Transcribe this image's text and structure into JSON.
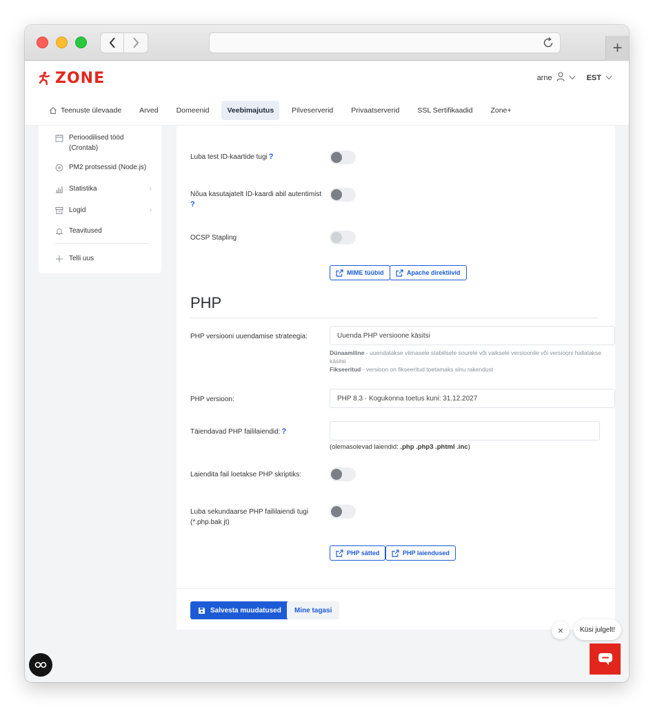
{
  "brand": {
    "logo_text": "ZONE",
    "accent": "#e3261d",
    "link": "#1d5bd6"
  },
  "user": {
    "name": "arne",
    "language": "EST"
  },
  "nav": {
    "items": [
      {
        "label": "Teenuste ülevaade",
        "icon": "home-icon"
      },
      {
        "label": "Arved"
      },
      {
        "label": "Domeenid"
      },
      {
        "label": "Veebimajutus",
        "active": true
      },
      {
        "label": "Pilveserverid"
      },
      {
        "label": "Privaatserverid"
      },
      {
        "label": "SSL Sertifikaadid"
      },
      {
        "label": "Zone+"
      }
    ]
  },
  "sidebar": {
    "items": [
      {
        "label": "Perioodilised tööd (Crontab)",
        "icon": "calendar-icon"
      },
      {
        "label": "PM2 protsessid (Node.js)",
        "icon": "nodejs-icon"
      },
      {
        "label": "Statistika",
        "icon": "chart-icon",
        "arrow": "›"
      },
      {
        "label": "Logid",
        "icon": "archive-icon",
        "arrow": "›"
      },
      {
        "label": "Teavitused",
        "icon": "bell-icon"
      }
    ],
    "order_new": "Telli uus"
  },
  "settings": {
    "id_card_test_label": "Luba test ID-kaartide tugi",
    "id_card_auth_label": "Nõua kasutajatelt ID-kaardi abil autentimist",
    "ocsp_label": "OCSP Stapling",
    "help_mark": "?",
    "mime_button": "MIME tüübid",
    "apache_button": "Apache direktiivid"
  },
  "php": {
    "section_title": "PHP",
    "strategy_label": "PHP versiooni uuendamise strateegia:",
    "strategy_value": "Uuenda PHP versioone käsitsi",
    "hint_dynamic_term": "Dünaamiline",
    "hint_dynamic_text": " - uuendatakse viimasele stabiilsele sourele või vaiksele versioonile või versiooni hallatakse käsitsi",
    "hint_fixed_term": "Fikseeritud",
    "hint_fixed_text": " - versioon on fikseeritud toetamaks sinu rakendust",
    "version_label": "PHP versioon:",
    "version_value": "PHP 8.3 · Kogukonna toetus kuni: 31.12.2027",
    "extensions_label": "Täiendavad PHP faililaiendid:",
    "extensions_value": "",
    "existing_prefix": "(olemasolevad laiendid: ",
    "existing_list": ".php .php3 .phtml .inc",
    "existing_suffix": ")",
    "no_ext_label": "Laiendita fail loetakse PHP skriptiks:",
    "secondary_label": "Luba sekundaarse PHP faililaiendi tugi (*.php.bak jt)",
    "settings_button": "PHP sätted",
    "extensions_button": "PHP laiendused"
  },
  "footer": {
    "save": "Salvesta muudatused",
    "back": "Mine tagasi"
  },
  "chat": {
    "close": "×",
    "bubble": "Küsi julgelt!"
  }
}
